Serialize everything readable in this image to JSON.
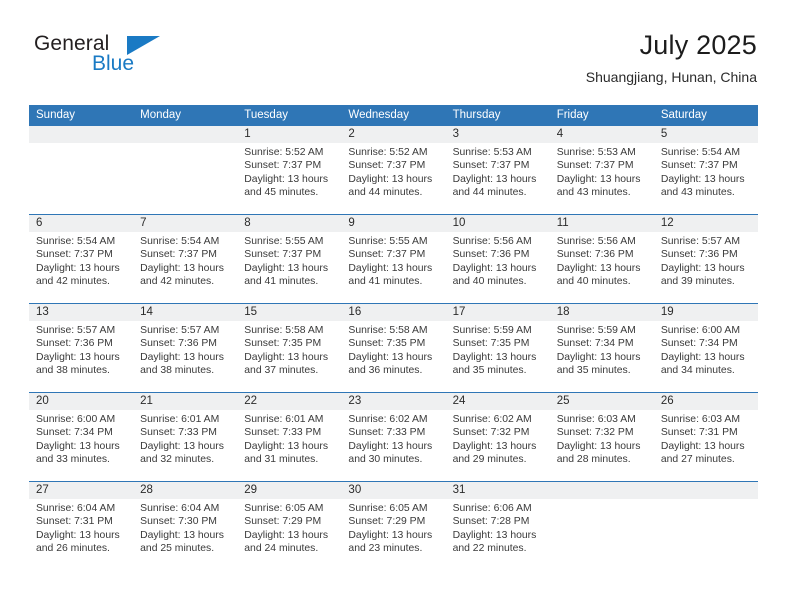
{
  "logo": {
    "word_one": "General",
    "word_two": "Blue",
    "triangle_icon": "triangle-icon",
    "accent_color": "#1a7ac4"
  },
  "header": {
    "title": "July 2025",
    "subtitle": "Shuangjiang, Hunan, China"
  },
  "calendar": {
    "header_color": "#2f76b6",
    "daynum_band_color": "#eff0f1",
    "weekdays": [
      "Sunday",
      "Monday",
      "Tuesday",
      "Wednesday",
      "Thursday",
      "Friday",
      "Saturday"
    ],
    "weeks": [
      [
        {
          "day": "",
          "sunrise": "",
          "sunset": "",
          "daylight_a": "",
          "daylight_b": ""
        },
        {
          "day": "",
          "sunrise": "",
          "sunset": "",
          "daylight_a": "",
          "daylight_b": ""
        },
        {
          "day": "1",
          "sunrise": "Sunrise: 5:52 AM",
          "sunset": "Sunset: 7:37 PM",
          "daylight_a": "Daylight: 13 hours",
          "daylight_b": "and 45 minutes."
        },
        {
          "day": "2",
          "sunrise": "Sunrise: 5:52 AM",
          "sunset": "Sunset: 7:37 PM",
          "daylight_a": "Daylight: 13 hours",
          "daylight_b": "and 44 minutes."
        },
        {
          "day": "3",
          "sunrise": "Sunrise: 5:53 AM",
          "sunset": "Sunset: 7:37 PM",
          "daylight_a": "Daylight: 13 hours",
          "daylight_b": "and 44 minutes."
        },
        {
          "day": "4",
          "sunrise": "Sunrise: 5:53 AM",
          "sunset": "Sunset: 7:37 PM",
          "daylight_a": "Daylight: 13 hours",
          "daylight_b": "and 43 minutes."
        },
        {
          "day": "5",
          "sunrise": "Sunrise: 5:54 AM",
          "sunset": "Sunset: 7:37 PM",
          "daylight_a": "Daylight: 13 hours",
          "daylight_b": "and 43 minutes."
        }
      ],
      [
        {
          "day": "6",
          "sunrise": "Sunrise: 5:54 AM",
          "sunset": "Sunset: 7:37 PM",
          "daylight_a": "Daylight: 13 hours",
          "daylight_b": "and 42 minutes."
        },
        {
          "day": "7",
          "sunrise": "Sunrise: 5:54 AM",
          "sunset": "Sunset: 7:37 PM",
          "daylight_a": "Daylight: 13 hours",
          "daylight_b": "and 42 minutes."
        },
        {
          "day": "8",
          "sunrise": "Sunrise: 5:55 AM",
          "sunset": "Sunset: 7:37 PM",
          "daylight_a": "Daylight: 13 hours",
          "daylight_b": "and 41 minutes."
        },
        {
          "day": "9",
          "sunrise": "Sunrise: 5:55 AM",
          "sunset": "Sunset: 7:37 PM",
          "daylight_a": "Daylight: 13 hours",
          "daylight_b": "and 41 minutes."
        },
        {
          "day": "10",
          "sunrise": "Sunrise: 5:56 AM",
          "sunset": "Sunset: 7:36 PM",
          "daylight_a": "Daylight: 13 hours",
          "daylight_b": "and 40 minutes."
        },
        {
          "day": "11",
          "sunrise": "Sunrise: 5:56 AM",
          "sunset": "Sunset: 7:36 PM",
          "daylight_a": "Daylight: 13 hours",
          "daylight_b": "and 40 minutes."
        },
        {
          "day": "12",
          "sunrise": "Sunrise: 5:57 AM",
          "sunset": "Sunset: 7:36 PM",
          "daylight_a": "Daylight: 13 hours",
          "daylight_b": "and 39 minutes."
        }
      ],
      [
        {
          "day": "13",
          "sunrise": "Sunrise: 5:57 AM",
          "sunset": "Sunset: 7:36 PM",
          "daylight_a": "Daylight: 13 hours",
          "daylight_b": "and 38 minutes."
        },
        {
          "day": "14",
          "sunrise": "Sunrise: 5:57 AM",
          "sunset": "Sunset: 7:36 PM",
          "daylight_a": "Daylight: 13 hours",
          "daylight_b": "and 38 minutes."
        },
        {
          "day": "15",
          "sunrise": "Sunrise: 5:58 AM",
          "sunset": "Sunset: 7:35 PM",
          "daylight_a": "Daylight: 13 hours",
          "daylight_b": "and 37 minutes."
        },
        {
          "day": "16",
          "sunrise": "Sunrise: 5:58 AM",
          "sunset": "Sunset: 7:35 PM",
          "daylight_a": "Daylight: 13 hours",
          "daylight_b": "and 36 minutes."
        },
        {
          "day": "17",
          "sunrise": "Sunrise: 5:59 AM",
          "sunset": "Sunset: 7:35 PM",
          "daylight_a": "Daylight: 13 hours",
          "daylight_b": "and 35 minutes."
        },
        {
          "day": "18",
          "sunrise": "Sunrise: 5:59 AM",
          "sunset": "Sunset: 7:34 PM",
          "daylight_a": "Daylight: 13 hours",
          "daylight_b": "and 35 minutes."
        },
        {
          "day": "19",
          "sunrise": "Sunrise: 6:00 AM",
          "sunset": "Sunset: 7:34 PM",
          "daylight_a": "Daylight: 13 hours",
          "daylight_b": "and 34 minutes."
        }
      ],
      [
        {
          "day": "20",
          "sunrise": "Sunrise: 6:00 AM",
          "sunset": "Sunset: 7:34 PM",
          "daylight_a": "Daylight: 13 hours",
          "daylight_b": "and 33 minutes."
        },
        {
          "day": "21",
          "sunrise": "Sunrise: 6:01 AM",
          "sunset": "Sunset: 7:33 PM",
          "daylight_a": "Daylight: 13 hours",
          "daylight_b": "and 32 minutes."
        },
        {
          "day": "22",
          "sunrise": "Sunrise: 6:01 AM",
          "sunset": "Sunset: 7:33 PM",
          "daylight_a": "Daylight: 13 hours",
          "daylight_b": "and 31 minutes."
        },
        {
          "day": "23",
          "sunrise": "Sunrise: 6:02 AM",
          "sunset": "Sunset: 7:33 PM",
          "daylight_a": "Daylight: 13 hours",
          "daylight_b": "and 30 minutes."
        },
        {
          "day": "24",
          "sunrise": "Sunrise: 6:02 AM",
          "sunset": "Sunset: 7:32 PM",
          "daylight_a": "Daylight: 13 hours",
          "daylight_b": "and 29 minutes."
        },
        {
          "day": "25",
          "sunrise": "Sunrise: 6:03 AM",
          "sunset": "Sunset: 7:32 PM",
          "daylight_a": "Daylight: 13 hours",
          "daylight_b": "and 28 minutes."
        },
        {
          "day": "26",
          "sunrise": "Sunrise: 6:03 AM",
          "sunset": "Sunset: 7:31 PM",
          "daylight_a": "Daylight: 13 hours",
          "daylight_b": "and 27 minutes."
        }
      ],
      [
        {
          "day": "27",
          "sunrise": "Sunrise: 6:04 AM",
          "sunset": "Sunset: 7:31 PM",
          "daylight_a": "Daylight: 13 hours",
          "daylight_b": "and 26 minutes."
        },
        {
          "day": "28",
          "sunrise": "Sunrise: 6:04 AM",
          "sunset": "Sunset: 7:30 PM",
          "daylight_a": "Daylight: 13 hours",
          "daylight_b": "and 25 minutes."
        },
        {
          "day": "29",
          "sunrise": "Sunrise: 6:05 AM",
          "sunset": "Sunset: 7:29 PM",
          "daylight_a": "Daylight: 13 hours",
          "daylight_b": "and 24 minutes."
        },
        {
          "day": "30",
          "sunrise": "Sunrise: 6:05 AM",
          "sunset": "Sunset: 7:29 PM",
          "daylight_a": "Daylight: 13 hours",
          "daylight_b": "and 23 minutes."
        },
        {
          "day": "31",
          "sunrise": "Sunrise: 6:06 AM",
          "sunset": "Sunset: 7:28 PM",
          "daylight_a": "Daylight: 13 hours",
          "daylight_b": "and 22 minutes."
        },
        {
          "day": "",
          "sunrise": "",
          "sunset": "",
          "daylight_a": "",
          "daylight_b": ""
        },
        {
          "day": "",
          "sunrise": "",
          "sunset": "",
          "daylight_a": "",
          "daylight_b": ""
        }
      ]
    ]
  }
}
